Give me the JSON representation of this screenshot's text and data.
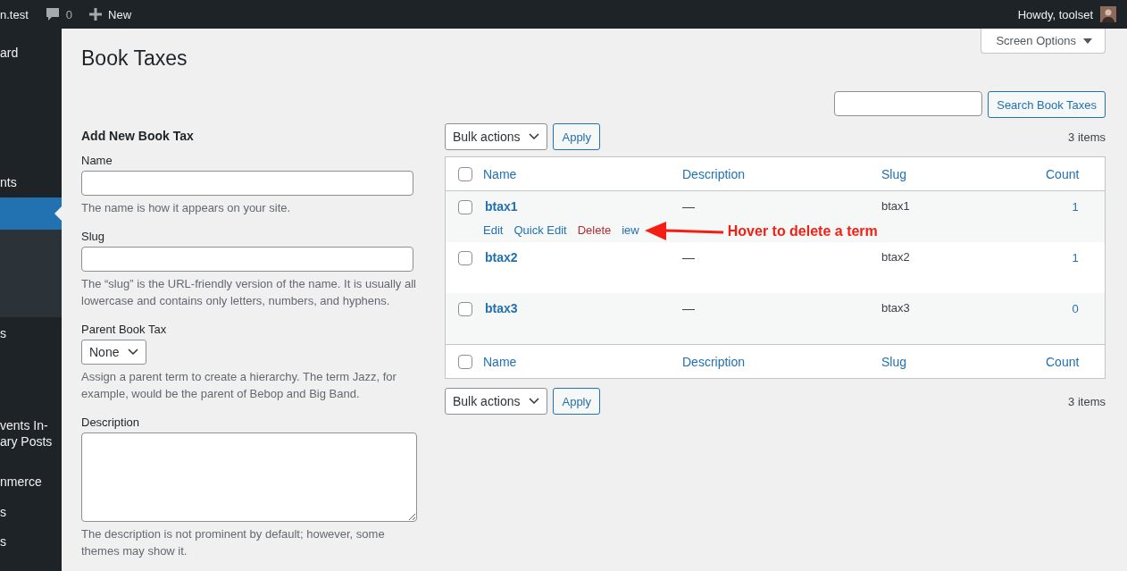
{
  "admin_bar": {
    "site": "n.test",
    "comments": "0",
    "new": "New",
    "greeting": "Howdy, toolset"
  },
  "sidebar": {
    "items": [
      {
        "label": "ard",
        "selected": false
      },
      {
        "label": "nts",
        "selected": false
      },
      {
        "selected": true
      },
      {
        "label": "s",
        "selected": false
      },
      {
        "label": "vents In-\nary Posts",
        "selected": false
      },
      {
        "label": "nmerce",
        "selected": false
      },
      {
        "label": "s",
        "selected": false
      },
      {
        "label": "s",
        "selected": false
      }
    ]
  },
  "screen_options": "Screen Options",
  "title": "Book Taxes",
  "search": {
    "button": "Search Book Taxes"
  },
  "form": {
    "heading": "Add New Book Tax",
    "fields": [
      {
        "kind": "text",
        "label": "Name",
        "help": "The name is how it appears on your site."
      },
      {
        "kind": "text",
        "label": "Slug",
        "help": "The “slug” is the URL-friendly version of the name. It is usually all lowercase and contains only letters, numbers, and hyphens."
      },
      {
        "kind": "select",
        "label": "Parent Book Tax",
        "value": "None",
        "help": "Assign a parent term to create a hierarchy. The term Jazz, for example, would be the parent of Bebop and Big Band."
      },
      {
        "kind": "textarea",
        "label": "Description",
        "help": "The description is not prominent by default; however, some themes may show it."
      }
    ]
  },
  "top_nav": {
    "bulk": "Bulk actions",
    "apply": "Apply",
    "count": "3 items"
  },
  "bottom_nav": {
    "bulk": "Bulk actions",
    "apply": "Apply",
    "count": "3 items"
  },
  "table": {
    "columns": [
      "Name",
      "Description",
      "Slug",
      "Count"
    ],
    "select_all_checked": false,
    "footer_columns": [
      "Name",
      "Description",
      "Slug",
      "Count"
    ],
    "rows": [
      {
        "name": "btax1",
        "description": "—",
        "slug": "btax1",
        "count": "1",
        "checked": false,
        "actions": [
          "Edit",
          "Quick Edit",
          "Delete",
          "iew"
        ]
      },
      {
        "name": "btax2",
        "description": "—",
        "slug": "btax2",
        "count": "1",
        "checked": false
      },
      {
        "name": "btax3",
        "description": "—",
        "slug": "btax3",
        "count": "0",
        "checked": false
      }
    ]
  },
  "annotation": {
    "text": "Hover to delete a term"
  }
}
